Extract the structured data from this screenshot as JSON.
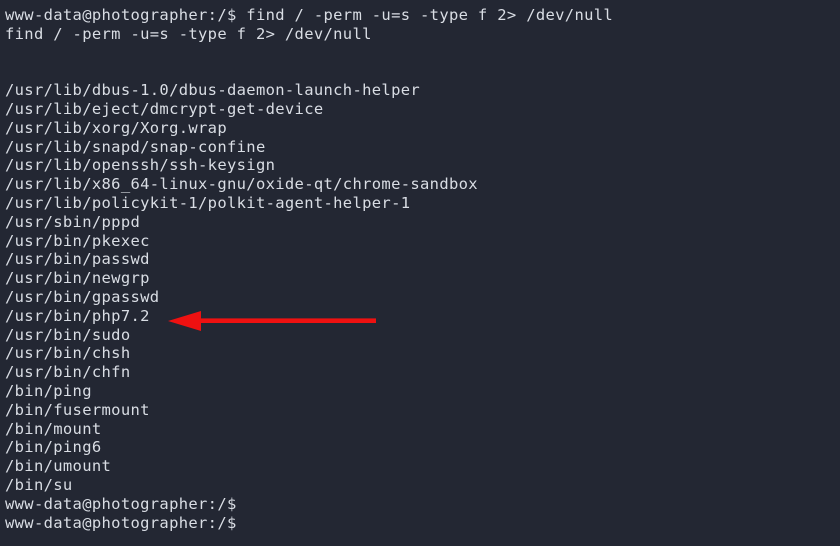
{
  "terminal": {
    "colors": {
      "background": "#232733",
      "foreground": "#d9dde4",
      "annotation": "#ee1111"
    },
    "prompt": "www-data@photographer:/$",
    "lines": [
      {
        "id": "prompt-command",
        "text": "www-data@photographer:/$ find / -perm -u=s -type f 2> /dev/null"
      },
      {
        "id": "echoed-command",
        "text": "find / -perm -u=s -type f 2> /dev/null"
      },
      {
        "id": "blank-1",
        "text": ""
      },
      {
        "id": "blank-2",
        "text": ""
      },
      {
        "id": "result-1",
        "text": "/usr/lib/dbus-1.0/dbus-daemon-launch-helper"
      },
      {
        "id": "result-2",
        "text": "/usr/lib/eject/dmcrypt-get-device"
      },
      {
        "id": "result-3",
        "text": "/usr/lib/xorg/Xorg.wrap"
      },
      {
        "id": "result-4",
        "text": "/usr/lib/snapd/snap-confine"
      },
      {
        "id": "result-5",
        "text": "/usr/lib/openssh/ssh-keysign"
      },
      {
        "id": "result-6",
        "text": "/usr/lib/x86_64-linux-gnu/oxide-qt/chrome-sandbox"
      },
      {
        "id": "result-7",
        "text": "/usr/lib/policykit-1/polkit-agent-helper-1"
      },
      {
        "id": "result-8",
        "text": "/usr/sbin/pppd"
      },
      {
        "id": "result-9",
        "text": "/usr/bin/pkexec"
      },
      {
        "id": "result-10",
        "text": "/usr/bin/passwd"
      },
      {
        "id": "result-11",
        "text": "/usr/bin/newgrp"
      },
      {
        "id": "result-12",
        "text": "/usr/bin/gpasswd"
      },
      {
        "id": "result-13",
        "text": "/usr/bin/php7.2"
      },
      {
        "id": "result-14",
        "text": "/usr/bin/sudo"
      },
      {
        "id": "result-15",
        "text": "/usr/bin/chsh"
      },
      {
        "id": "result-16",
        "text": "/usr/bin/chfn"
      },
      {
        "id": "result-17",
        "text": "/bin/ping"
      },
      {
        "id": "result-18",
        "text": "/bin/fusermount"
      },
      {
        "id": "result-19",
        "text": "/bin/mount"
      },
      {
        "id": "result-20",
        "text": "/bin/ping6"
      },
      {
        "id": "result-21",
        "text": "/bin/umount"
      },
      {
        "id": "result-22",
        "text": "/bin/su"
      },
      {
        "id": "prompt-2",
        "text": "www-data@photographer:/$"
      },
      {
        "id": "prompt-3",
        "text": "www-data@photographer:/$"
      }
    ],
    "annotation": {
      "kind": "arrow-left",
      "points_at": "/usr/bin/php7.2",
      "color": "#ee1111"
    }
  }
}
